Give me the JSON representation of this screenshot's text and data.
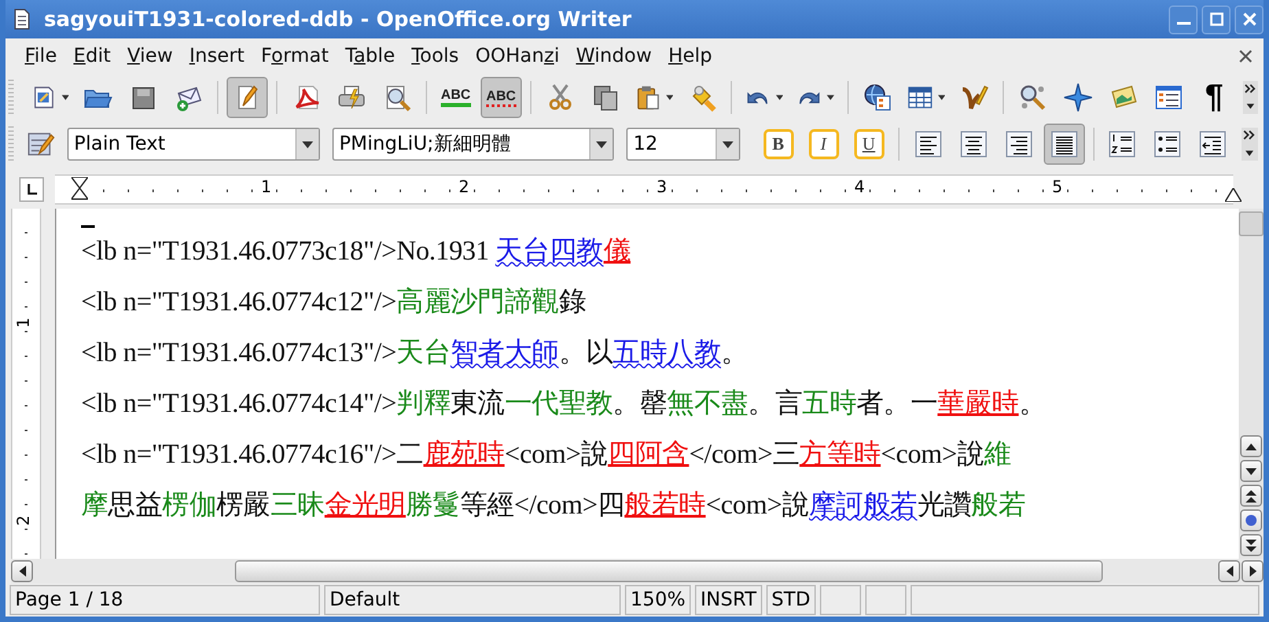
{
  "window": {
    "title": "sagyouiT1931-colored-ddb - OpenOffice.org Writer"
  },
  "menu": [
    {
      "key": "F",
      "after": "ile"
    },
    {
      "key": "E",
      "after": "dit"
    },
    {
      "key": "V",
      "after": "iew"
    },
    {
      "key": "I",
      "after": "nsert"
    },
    {
      "before": "F",
      "key": "o",
      "after": "rmat"
    },
    {
      "before": "T",
      "key": "a",
      "after": "ble"
    },
    {
      "key": "T",
      "after": "ools"
    },
    {
      "before": "OOHan",
      "key": "z",
      "after": "i"
    },
    {
      "key": "W",
      "after": "indow"
    },
    {
      "key": "H",
      "after": "elp"
    }
  ],
  "standard_toolbar": [
    {
      "kind": "new",
      "pressed": false,
      "dropdown": true
    },
    {
      "kind": "open",
      "pressed": false,
      "dropdown": false
    },
    {
      "kind": "save",
      "pressed": false,
      "dropdown": false
    },
    {
      "kind": "email",
      "pressed": false,
      "dropdown": false
    },
    {
      "kind": "sep"
    },
    {
      "kind": "edit",
      "pressed": true,
      "dropdown": false
    },
    {
      "kind": "sep"
    },
    {
      "kind": "pdf",
      "pressed": false,
      "dropdown": false
    },
    {
      "kind": "print",
      "pressed": false,
      "dropdown": false
    },
    {
      "kind": "preview",
      "pressed": false,
      "dropdown": false
    },
    {
      "kind": "sep"
    },
    {
      "kind": "spell",
      "label": "ABC",
      "pressed": false,
      "dropdown": false
    },
    {
      "kind": "autospell",
      "label": "ABC",
      "pressed": true,
      "dropdown": false
    },
    {
      "kind": "sep"
    },
    {
      "kind": "cut",
      "pressed": false,
      "dropdown": false
    },
    {
      "kind": "copy",
      "pressed": false,
      "dropdown": false
    },
    {
      "kind": "paste",
      "pressed": false,
      "dropdown": true
    },
    {
      "kind": "brush",
      "pressed": false,
      "dropdown": false
    },
    {
      "kind": "sep"
    },
    {
      "kind": "undo",
      "pressed": false,
      "dropdown": true
    },
    {
      "kind": "redo",
      "pressed": false,
      "dropdown": true
    },
    {
      "kind": "sep"
    },
    {
      "kind": "globe",
      "pressed": false,
      "dropdown": false
    },
    {
      "kind": "table",
      "pressed": false,
      "dropdown": true
    },
    {
      "kind": "draw",
      "pressed": false,
      "dropdown": false
    },
    {
      "kind": "sep"
    },
    {
      "kind": "find",
      "pressed": false,
      "dropdown": false
    },
    {
      "kind": "star",
      "pressed": false,
      "dropdown": false
    },
    {
      "kind": "gallery",
      "pressed": false,
      "dropdown": false
    },
    {
      "kind": "datasource",
      "pressed": false,
      "dropdown": false
    },
    {
      "kind": "pilcrow",
      "label": "¶",
      "pressed": false,
      "dropdown": false
    }
  ],
  "format_toolbar": {
    "style": "Plain Text",
    "font": "PMingLiU;新細明體",
    "size": "12",
    "buttons": [
      {
        "kind": "bold",
        "label": "B",
        "pressed": false
      },
      {
        "kind": "italic",
        "label": "I",
        "pressed": false
      },
      {
        "kind": "underline",
        "label": "U",
        "pressed": false
      },
      {
        "kind": "sep"
      },
      {
        "kind": "left",
        "pressed": false
      },
      {
        "kind": "center",
        "pressed": false
      },
      {
        "kind": "right",
        "pressed": false
      },
      {
        "kind": "justify",
        "pressed": true
      },
      {
        "kind": "sep"
      },
      {
        "kind": "numbering",
        "pressed": false
      },
      {
        "kind": "bullets",
        "pressed": false
      },
      {
        "kind": "indent",
        "pressed": false
      }
    ]
  },
  "ruler": {
    "labels": [
      "1",
      "2",
      "3",
      "4",
      "5"
    ]
  },
  "vertical_ruler": {
    "labels": [
      "1",
      "2"
    ]
  },
  "document": {
    "lines": [
      [
        {
          "text": "<lb n=\"T1931.46.0773c18\"/>No.1931 ",
          "kind": "plain"
        },
        {
          "text": "天台四教",
          "kind": "term"
        },
        {
          "text": "儀",
          "kind": "title"
        }
      ],
      [
        {
          "text": "<lb n=\"T1931.46.0774c12\"/>",
          "kind": "plain"
        },
        {
          "text": "高麗沙門諦觀",
          "kind": "name"
        },
        {
          "text": "錄",
          "kind": "plain"
        }
      ],
      [
        {
          "text": "<lb n=\"T1931.46.0774c13\"/>",
          "kind": "plain"
        },
        {
          "text": "天台",
          "kind": "name"
        },
        {
          "text": "智者大師",
          "kind": "term"
        },
        {
          "text": "。以",
          "kind": "plain"
        },
        {
          "text": "五時八教",
          "kind": "term"
        },
        {
          "text": "。",
          "kind": "plain"
        }
      ],
      [
        {
          "text": "<lb n=\"T1931.46.0774c14\"/>",
          "kind": "plain"
        },
        {
          "text": "判釋",
          "kind": "name"
        },
        {
          "text": "東流",
          "kind": "plain"
        },
        {
          "text": "一代聖教",
          "kind": "name"
        },
        {
          "text": "。罄",
          "kind": "plain"
        },
        {
          "text": "無不盡",
          "kind": "name"
        },
        {
          "text": "。言",
          "kind": "plain"
        },
        {
          "text": "五時",
          "kind": "name"
        },
        {
          "text": "者。一",
          "kind": "plain"
        },
        {
          "text": "華嚴時",
          "kind": "title"
        },
        {
          "text": "。",
          "kind": "plain"
        }
      ],
      [
        {
          "text": "<lb n=\"T1931.46.0774c16\"/>二",
          "kind": "plain"
        },
        {
          "text": "鹿苑時",
          "kind": "title"
        },
        {
          "text": "<com>說",
          "kind": "plain"
        },
        {
          "text": "四阿含",
          "kind": "title"
        },
        {
          "text": "</com>三",
          "kind": "plain"
        },
        {
          "text": "方等時",
          "kind": "title"
        },
        {
          "text": "<com>說",
          "kind": "plain"
        },
        {
          "text": "維",
          "kind": "name"
        }
      ],
      [
        {
          "text": "摩",
          "kind": "name"
        },
        {
          "text": "思益",
          "kind": "plain"
        },
        {
          "text": "楞伽",
          "kind": "name"
        },
        {
          "text": "楞嚴",
          "kind": "plain"
        },
        {
          "text": "三昧",
          "kind": "name"
        },
        {
          "text": "金光明",
          "kind": "title"
        },
        {
          "text": "勝鬘",
          "kind": "name"
        },
        {
          "text": "等經</com>四",
          "kind": "plain"
        },
        {
          "text": "般若時",
          "kind": "title"
        },
        {
          "text": "<com>說",
          "kind": "plain"
        },
        {
          "text": "摩訶般若",
          "kind": "term"
        },
        {
          "text": "光讚",
          "kind": "plain"
        },
        {
          "text": "般若",
          "kind": "name"
        }
      ]
    ]
  },
  "status_bar": {
    "page": "Page 1 / 18",
    "page_style": "Default",
    "zoom": "150%",
    "insert_mode": "INSRT",
    "selection_mode": "STD"
  }
}
